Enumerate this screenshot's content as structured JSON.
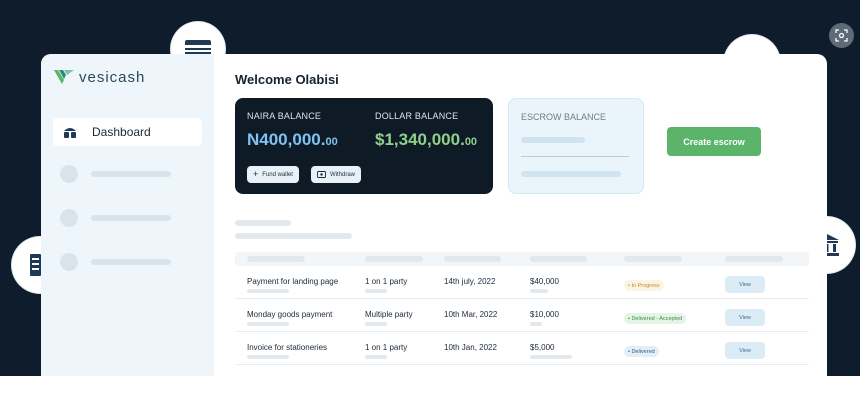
{
  "brand": {
    "name": "vesicash"
  },
  "sidebar": {
    "active_item": {
      "label": "Dashboard",
      "icon": "dashboard-icon"
    }
  },
  "welcome": "Welcome Olabisi",
  "naira": {
    "label": "NAIRA BALANCE",
    "whole": "N400,000.",
    "cents": "00"
  },
  "dollar": {
    "label": "DOLLAR BALANCE",
    "whole": "$1,340,000.",
    "cents": "00"
  },
  "actions": {
    "fund_wallet": "Fund wallet",
    "withdraw": "Withdraw"
  },
  "escrow": {
    "label": "ESCROW BALANCE"
  },
  "create_escrow": "Create escrow",
  "table": {
    "rows": [
      {
        "name": "Payment for landing page",
        "parties": "1 on 1 party",
        "date": "14th july, 2022",
        "amount": "$40,000",
        "status": "• In Progress",
        "action": "View"
      },
      {
        "name": "Monday goods payment",
        "parties": "Multiple party",
        "date": "10th Mar, 2022",
        "amount": "$10,000",
        "status": "• Delivered - Accepted",
        "action": "View"
      },
      {
        "name": "Invoice for stationeries",
        "parties": "1 on 1 party",
        "date": "10th Jan, 2022",
        "amount": "$5,000",
        "status": "• Delivered",
        "action": "View"
      }
    ]
  },
  "colors": {
    "background": "#0f1c2b",
    "naira_value": "#7fc3f0",
    "dollar_value": "#8fd08a",
    "accent_green": "#5cb46a",
    "in_progress_bg": "#fbf3e4",
    "in_progress_text": "#c98a2c",
    "delivered_bg": "#e4f4e6",
    "delivered_text": "#3d8a4a",
    "delivered_blue_bg": "#e3eff8",
    "delivered_blue_text": "#2d5a7a"
  },
  "floating_icons": [
    "credit-card-icon",
    "cash-icon",
    "document-icon",
    "bank-icon",
    "scan-icon"
  ]
}
